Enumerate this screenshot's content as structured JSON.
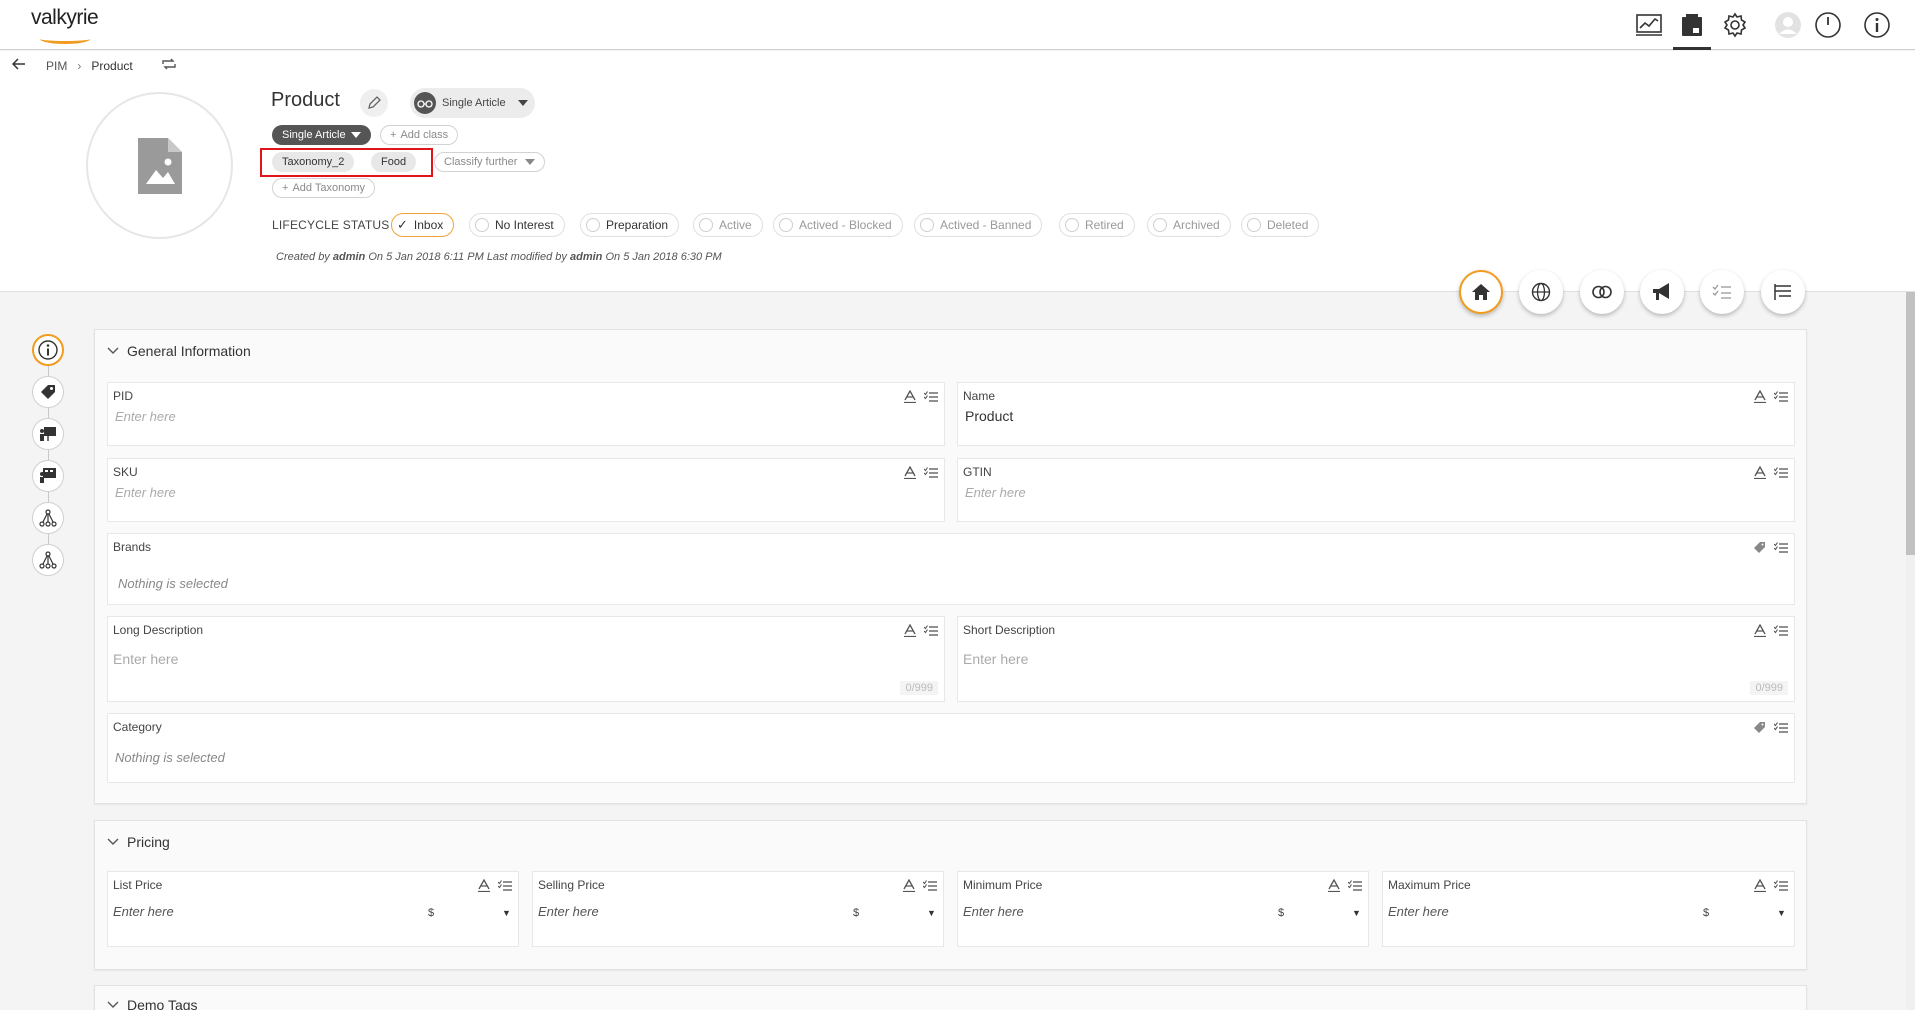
{
  "app": {
    "logo": "valkyrie"
  },
  "topbar": {
    "icons": [
      "dashboard-icon",
      "product-icon",
      "settings-gear-icon",
      "user-avatar-icon",
      "power-icon",
      "info-icon"
    ]
  },
  "breadcrumb": {
    "root": "PIM",
    "current": "Product"
  },
  "product": {
    "title": "Product",
    "view_label": "Single Article",
    "class_label": "Single Article",
    "add_class": "Add class",
    "taxonomies": [
      "Taxonomy_2",
      "Food"
    ],
    "classify_further": "Classify further",
    "add_taxonomy": "Add Taxonomy"
  },
  "lifecycle": {
    "label": "LIFECYCLE STATUS",
    "statuses": [
      "Inbox",
      "No Interest",
      "Preparation",
      "Active",
      "Actived - Blocked",
      "Actived - Banned",
      "Retired",
      "Archived",
      "Deleted"
    ],
    "selected": "Inbox"
  },
  "meta": {
    "created_by_label": "Created by",
    "created_by": "admin",
    "created_on_label": "On",
    "created_on": "5 Jan 2018 6:11 PM",
    "modified_by_label": "Last modified by",
    "modified_by": "admin",
    "modified_on_label": "On",
    "modified_on": "5 Jan 2018 6:30 PM"
  },
  "general": {
    "title": "General Information",
    "placeholder": "Enter here",
    "nothing_selected": "Nothing is selected",
    "pid_label": "PID",
    "name_label": "Name",
    "name_value": "Product",
    "sku_label": "SKU",
    "gtin_label": "GTIN",
    "brands_label": "Brands",
    "long_desc_label": "Long Description",
    "short_desc_label": "Short Description",
    "counter": "0/999",
    "category_label": "Category"
  },
  "pricing": {
    "title": "Pricing",
    "placeholder": "Enter here",
    "currency": "$",
    "list_label": "List Price",
    "selling_label": "Selling Price",
    "minimum_label": "Minimum Price",
    "maximum_label": "Maximum Price"
  },
  "demo_tags": {
    "title": "Demo Tags"
  },
  "colors": {
    "accent": "#f29b1d",
    "highlight": "#e0141c"
  }
}
